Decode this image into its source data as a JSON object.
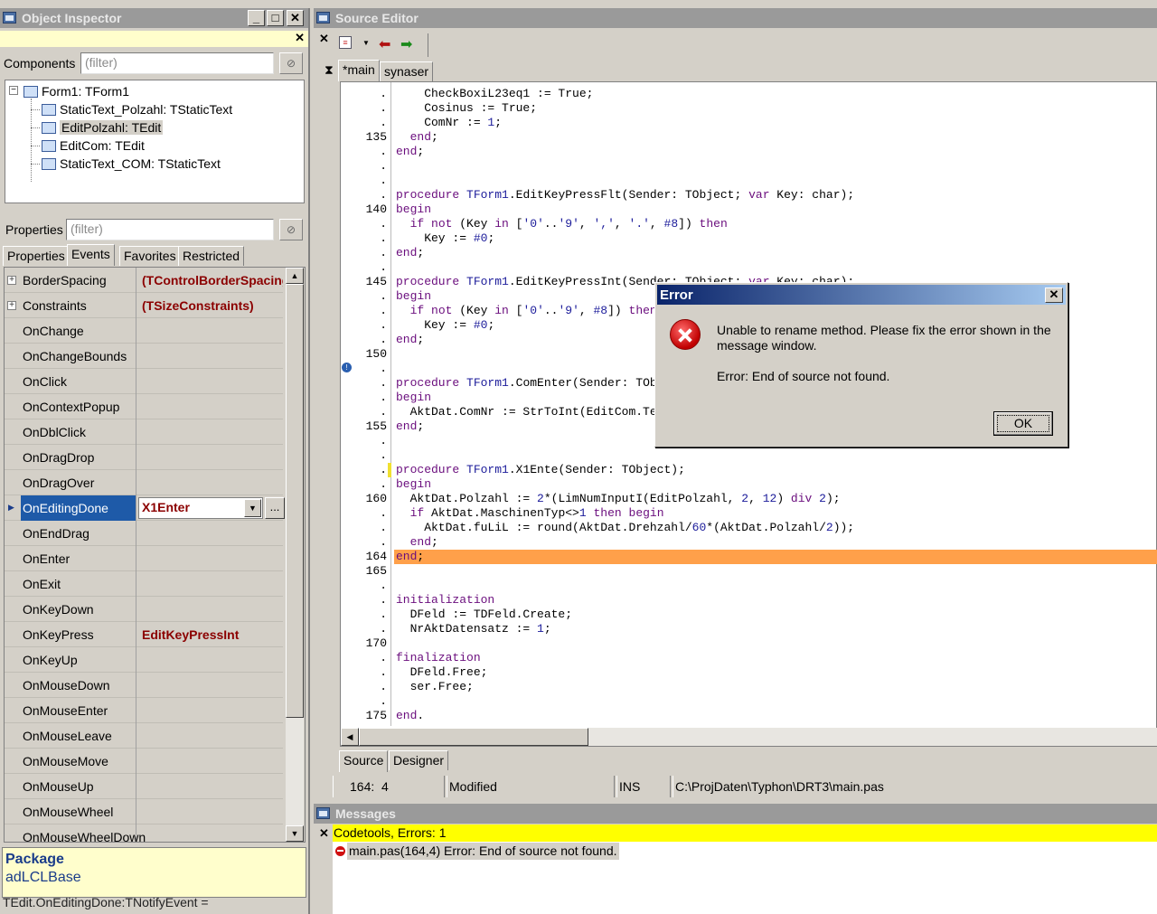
{
  "object_inspector": {
    "title": "Object Inspector",
    "components_label": "Components",
    "components_filter_placeholder": "(filter)",
    "tree": [
      {
        "label": "Form1: TForm1",
        "level": 0
      },
      {
        "label": "StaticText_Polzahl: TStaticText",
        "level": 1
      },
      {
        "label": "EditPolzahl: TEdit",
        "level": 1,
        "selected": true
      },
      {
        "label": "EditCom: TEdit",
        "level": 1
      },
      {
        "label": "StaticText_COM: TStaticText",
        "level": 1
      }
    ],
    "properties_label": "Properties",
    "properties_filter_placeholder": "(filter)",
    "tabs": [
      "Properties",
      "Events",
      "Favorites",
      "Restricted"
    ],
    "active_tab": "Events",
    "grid": [
      {
        "name": "BorderSpacing",
        "value": "(TControlBorderSpacing)",
        "expandable": true
      },
      {
        "name": "Constraints",
        "value": "(TSizeConstraints)",
        "expandable": true
      },
      {
        "name": "OnChange",
        "value": ""
      },
      {
        "name": "OnChangeBounds",
        "value": ""
      },
      {
        "name": "OnClick",
        "value": ""
      },
      {
        "name": "OnContextPopup",
        "value": ""
      },
      {
        "name": "OnDblClick",
        "value": ""
      },
      {
        "name": "OnDragDrop",
        "value": ""
      },
      {
        "name": "OnDragOver",
        "value": ""
      },
      {
        "name": "OnEditingDone",
        "value": "X1Enter",
        "selected": true
      },
      {
        "name": "OnEndDrag",
        "value": ""
      },
      {
        "name": "OnEnter",
        "value": ""
      },
      {
        "name": "OnExit",
        "value": ""
      },
      {
        "name": "OnKeyDown",
        "value": ""
      },
      {
        "name": "OnKeyPress",
        "value": "EditKeyPressInt"
      },
      {
        "name": "OnKeyUp",
        "value": ""
      },
      {
        "name": "OnMouseDown",
        "value": ""
      },
      {
        "name": "OnMouseEnter",
        "value": ""
      },
      {
        "name": "OnMouseLeave",
        "value": ""
      },
      {
        "name": "OnMouseMove",
        "value": ""
      },
      {
        "name": "OnMouseUp",
        "value": ""
      },
      {
        "name": "OnMouseWheel",
        "value": ""
      },
      {
        "name": "OnMouseWheelDown",
        "value": ""
      }
    ],
    "ellipsis": "...",
    "info_title": "Package",
    "info_value": "adLCLBase",
    "status": "TEdit.OnEditingDone:TNotifyEvent ="
  },
  "source_editor": {
    "title": "Source Editor",
    "tabs": [
      "*main",
      "synaser"
    ],
    "active_tab": "*main",
    "bottom_tabs": [
      "Source",
      "Designer"
    ],
    "status": {
      "position": "164:  4",
      "modified": "Modified",
      "mode": "INS",
      "file": "C:\\ProjDaten\\Typhon\\DRT3\\main.pas"
    },
    "lines": [
      {
        "n": ".",
        "t": "    CheckBoxiL23eq1 := True;"
      },
      {
        "n": ".",
        "t": "    Cosinus := True;"
      },
      {
        "n": ".",
        "t": "    ComNr := 1;"
      },
      {
        "n": "135",
        "t": "  end;"
      },
      {
        "n": ".",
        "t": "end;"
      },
      {
        "n": ".",
        "t": ""
      },
      {
        "n": ".",
        "t": ""
      },
      {
        "n": ".",
        "t": "procedure TForm1.EditKeyPressFlt(Sender: TObject; var Key: char);"
      },
      {
        "n": "140",
        "t": "begin"
      },
      {
        "n": ".",
        "t": "  if not (Key in ['0'..'9', ',', '.', #8]) then"
      },
      {
        "n": ".",
        "t": "    Key := #0;"
      },
      {
        "n": ".",
        "t": "end;"
      },
      {
        "n": ".",
        "t": ""
      },
      {
        "n": "145",
        "t": "procedure TForm1.EditKeyPressInt(Sender: TObject; var Key: char);"
      },
      {
        "n": ".",
        "t": "begin"
      },
      {
        "n": ".",
        "t": "  if not (Key in ['0'..'9', #8]) then"
      },
      {
        "n": ".",
        "t": "    Key := #0;"
      },
      {
        "n": ".",
        "t": "end;"
      },
      {
        "n": "150",
        "t": ""
      },
      {
        "n": ".",
        "t": ""
      },
      {
        "n": ".",
        "t": "procedure TForm1.ComEnter(Sender: TObject);"
      },
      {
        "n": ".",
        "t": "begin"
      },
      {
        "n": ".",
        "t": "  AktDat.ComNr := StrToInt(EditCom.Text);"
      },
      {
        "n": "155",
        "t": "end;"
      },
      {
        "n": ".",
        "t": ""
      },
      {
        "n": ".",
        "t": ""
      },
      {
        "n": ".",
        "t": "procedure TForm1.X1Ente(Sender: TObject);"
      },
      {
        "n": ".",
        "t": "begin"
      },
      {
        "n": "160",
        "t": "  AktDat.Polzahl := 2*(LimNumInputI(EditPolzahl, 2, 12) div 2);"
      },
      {
        "n": ".",
        "t": "  if AktDat.MaschinenTyp<>1 then begin"
      },
      {
        "n": ".",
        "t": "    AktDat.fuLiL := round(AktDat.Drehzahl/60*(AktDat.Polzahl/2));"
      },
      {
        "n": ".",
        "t": "  end;"
      },
      {
        "n": "164",
        "t": "end;",
        "current": true
      },
      {
        "n": "165",
        "t": ""
      },
      {
        "n": ".",
        "t": ""
      },
      {
        "n": ".",
        "t": "initialization"
      },
      {
        "n": ".",
        "t": "  DFeld := TDFeld.Create;"
      },
      {
        "n": ".",
        "t": "  NrAktDatensatz := 1;"
      },
      {
        "n": "170",
        "t": ""
      },
      {
        "n": ".",
        "t": "finalization"
      },
      {
        "n": ".",
        "t": "  DFeld.Free;"
      },
      {
        "n": ".",
        "t": "  ser.Free;"
      },
      {
        "n": ".",
        "t": ""
      },
      {
        "n": "175",
        "t": "end."
      }
    ]
  },
  "messages": {
    "title": "Messages",
    "header": "Codetools, Errors: 1",
    "items": [
      "main.pas(164,4) Error: End of source not found."
    ]
  },
  "dialog": {
    "title": "Error",
    "line1": "Unable to rename method. Please fix the error shown in the",
    "line2": "message window.",
    "line3": "Error: End of source not found.",
    "ok": "OK"
  }
}
